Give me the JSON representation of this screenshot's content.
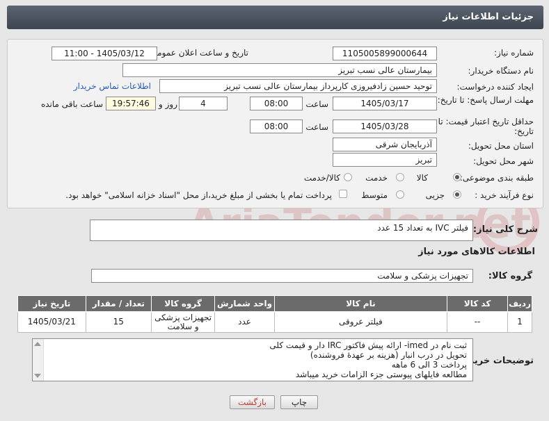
{
  "header": {
    "title": "جزئیات اطلاعات نیاز"
  },
  "form": {
    "need_number": {
      "label": "شماره نیاز:",
      "value": "1105005899000644"
    },
    "announce": {
      "label": "تاریخ و ساعت اعلان عمومی:",
      "value": "1405/03/12 - 11:00"
    },
    "buyer_org": {
      "label": "نام دستگاه خریدار:",
      "value": "بیمارستان عالی نسب تبریز"
    },
    "requester": {
      "label": "ایجاد کننده درخواست:",
      "value": "توحید حسین زادفیروزی کارپرداز بیمارستان عالی نسب تبریز"
    },
    "contact_link": "اطلاعات تماس خریدار",
    "reply_deadline": {
      "label": "مهلت ارسال پاسخ: تا تاریخ:",
      "date": "1405/03/17",
      "time_label": "ساعت",
      "time": "08:00",
      "days": "4",
      "days_label": "روز و",
      "remaining": "19:57:46",
      "remaining_label": "ساعت باقی مانده"
    },
    "price_validity": {
      "label": "حداقل تاریخ اعتبار قیمت: تا تاریخ:",
      "date": "1405/03/28",
      "time_label": "ساعت",
      "time": "08:00"
    },
    "province": {
      "label": "استان محل تحویل:",
      "value": "آذربایجان شرقی"
    },
    "city": {
      "label": "شهر محل تحویل:",
      "value": "تبریز"
    },
    "category": {
      "label": "طبقه بندی موضوعی:",
      "options": [
        "کالا",
        "خدمت",
        "کالا/خدمت"
      ],
      "selected": "کالا"
    },
    "purchase_type": {
      "label": "نوع فرآیند خرید :",
      "options": [
        "جزیی",
        "متوسط"
      ],
      "selected": "جزیی",
      "treasury_note": "پرداخت تمام یا بخشی از مبلغ خرید،از محل \"اسناد خزانه اسلامی\" خواهد بود."
    }
  },
  "general_description": {
    "label": "شرح کلی نیاز:",
    "value": "فیلتر IVC به تعداد 15 عدد"
  },
  "goods_section_title": "اطلاعات کالاهای مورد نیاز",
  "goods_group": {
    "label": "گروه کالا:",
    "value": "تجهیزات پزشکی و سلامت"
  },
  "table": {
    "headers": [
      "ردیف",
      "کد کالا",
      "نام کالا",
      "واحد شمارش",
      "گروه کالا",
      "تعداد / مقدار",
      "تاریخ نیاز"
    ],
    "rows": [
      [
        "1",
        "--",
        "فیلتر عروقی",
        "عدد",
        "تجهیزات پزشکی و سلامت",
        "15",
        "1405/03/21"
      ]
    ]
  },
  "buyer_notes": {
    "label": "توضیحات خریدار:",
    "lines": [
      "ثبت نام در imed- ارائه پیش فاکتور IRC دار و قیمت کلی",
      "تحویل در درب انبار (هزینه بر عهدهٔ فروشنده)",
      "پرداخت  3 الی 6 ماهه",
      "مطالعه فایلهای پیوستی جزء الزامات خرید میباشد"
    ]
  },
  "buttons": {
    "print": "چاپ",
    "back": "بازگشت"
  },
  "watermark_text": "AriaTender.net"
}
